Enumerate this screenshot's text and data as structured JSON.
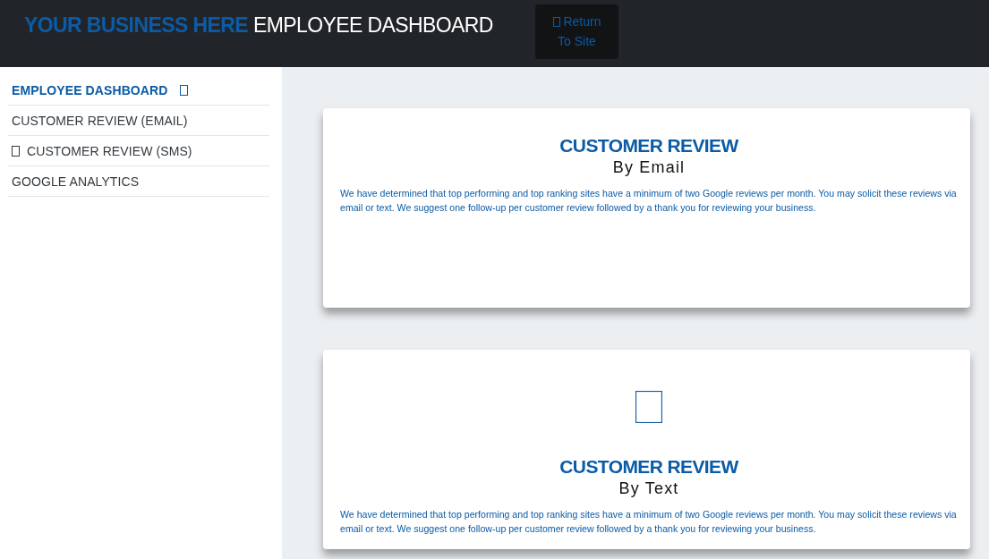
{
  "header": {
    "brand": "YOUR BUSINESS HERE",
    "title": "EMPLOYEE DASHBOARD",
    "return_button": {
      "label": "Return To Site",
      "icon": true
    }
  },
  "sidebar": {
    "items": [
      {
        "label": "EMPLOYEE DASHBOARD",
        "selected": true,
        "kind": "trailing"
      },
      {
        "label": "CUSTOMER REVIEW (EMAIL)",
        "selected": false,
        "kind": "plain"
      },
      {
        "label": "CUSTOMER REVIEW (SMS)",
        "selected": false,
        "kind": "leading"
      },
      {
        "label": "GOOGLE ANALYTICS",
        "selected": false,
        "kind": "plain"
      }
    ]
  },
  "cards": [
    {
      "title": "CUSTOMER REVIEW",
      "subtitle": "By Email",
      "text": "We have determined that top performing and top ranking sites have a minimum of two Google reviews per month. You may solicit these reviews via email or text. We suggest one follow-up per customer review followed by a thank you for reviewing your business.",
      "icon": false
    },
    {
      "title": "CUSTOMER REVIEW",
      "subtitle": "By Text",
      "text": "We have determined that top performing and top ranking sites have a minimum of two Google reviews per month. You may solicit these reviews via email or text. We suggest one follow-up per customer review followed by a thank you for reviewing your business.",
      "icon": true
    }
  ]
}
